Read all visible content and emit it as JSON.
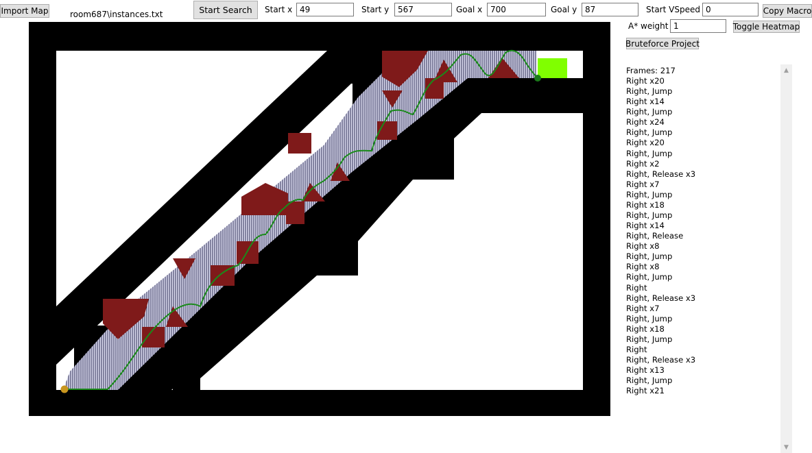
{
  "toolbar": {
    "import_map_label": "Import Map",
    "file_path": "room687\\instances.txt",
    "start_search_label": "Start Search",
    "start_x_label": "Start x",
    "start_x_value": "49",
    "start_y_label": "Start y",
    "start_y_value": "567",
    "goal_x_label": "Goal x",
    "goal_x_value": "700",
    "goal_y_label": "Goal y",
    "goal_y_value": "87",
    "start_vspeed_label": "Start VSpeed",
    "start_vspeed_value": "0",
    "copy_macro_label": "Copy Macro",
    "astar_weight_label": "A* weight",
    "astar_weight_value": "1",
    "toggle_heatmap_label": "Toggle Heatmap",
    "bruteforce_label": "Bruteforce Project"
  },
  "colors": {
    "wall": "#000000",
    "spike": "#7f1a1a",
    "path": "#1a8a1a",
    "goal": "#80ff00",
    "start_marker": "#c8961e",
    "end_marker": "#1a7a1a",
    "hatch": "#1a1a4a"
  },
  "output": {
    "frames": "Frames: 217",
    "steps": [
      "Right x20",
      "Right, Jump",
      "Right x14",
      "Right, Jump",
      "Right x24",
      "Right, Jump",
      "Right x20",
      "Right, Jump",
      "Right x2",
      "Right, Release x3",
      "Right x7",
      "Right, Jump",
      "Right x18",
      "Right, Jump",
      "Right x14",
      "Right, Release",
      "Right x8",
      "Right, Jump",
      "Right x8",
      "Right, Jump",
      "Right",
      "Right, Release x3",
      "Right x7",
      "Right, Jump",
      "Right x18",
      "Right, Jump",
      "Right",
      "Right, Release x3",
      "Right x13",
      "Right, Jump",
      "Right x21"
    ]
  }
}
